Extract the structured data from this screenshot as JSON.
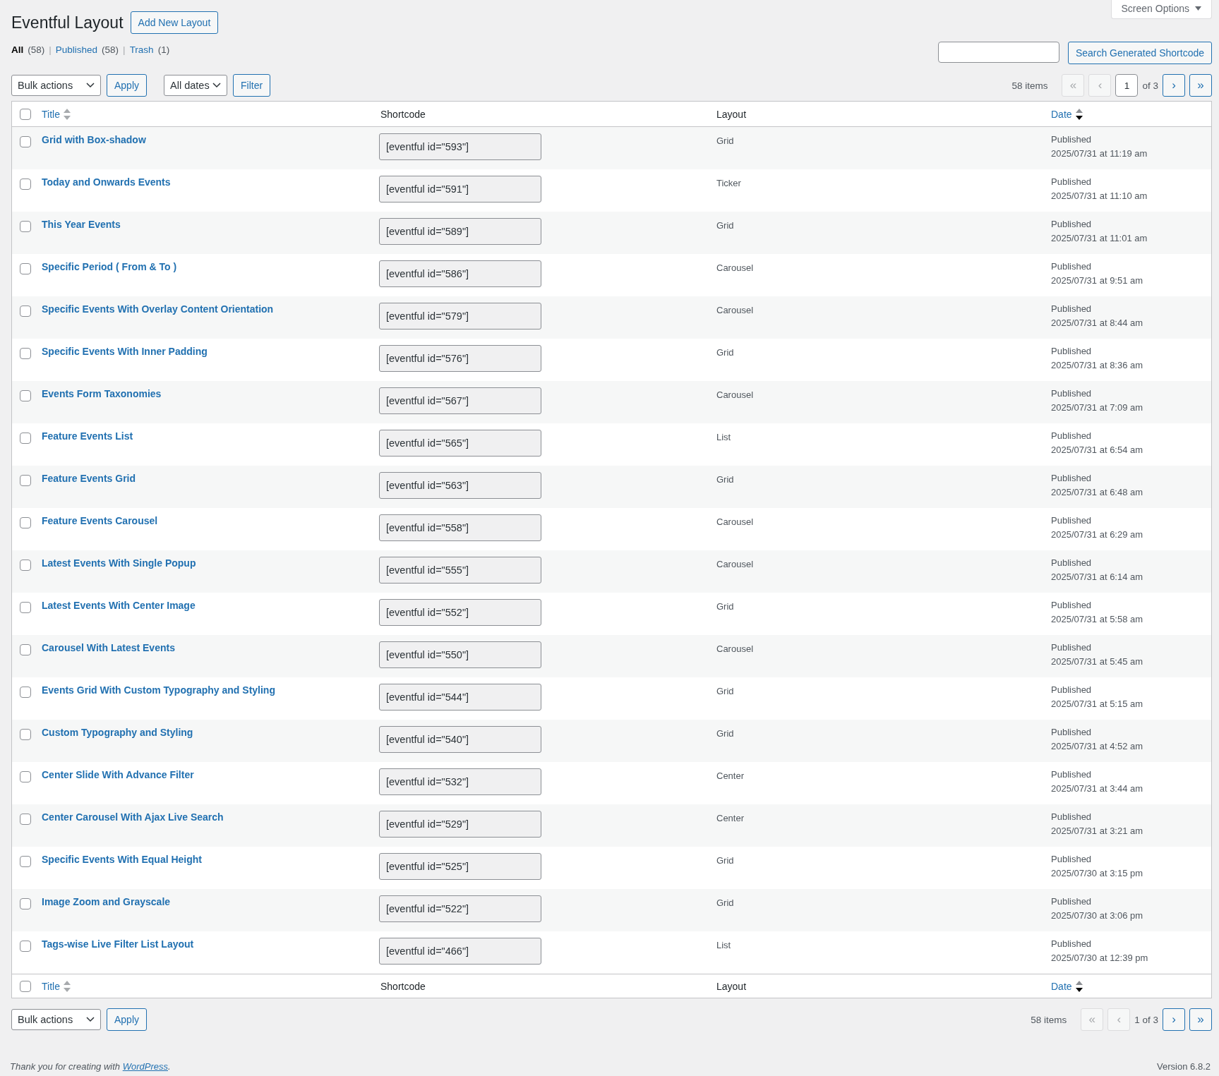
{
  "screen_options": {
    "label": "Screen Options",
    "expanded": false
  },
  "title": "Eventful Layout",
  "add_button": "Add New Layout",
  "views": [
    {
      "label": "All",
      "count": "(58)",
      "selected": true
    },
    {
      "label": "Published",
      "count": "(58)",
      "selected": false
    },
    {
      "label": "Trash",
      "count": "(1)",
      "selected": false
    }
  ],
  "view_separator": "|",
  "search": {
    "button": "Search Generated Shortcode"
  },
  "top_nav": {
    "bulk": "Bulk actions",
    "apply": "Apply",
    "dates": "All dates",
    "filter": "Filter",
    "items": "58 items",
    "page": "1",
    "of": "of 3",
    "buttons": [
      {
        "label": "«",
        "disabled": true
      },
      {
        "label": "‹",
        "disabled": true
      },
      {
        "label": "›",
        "disabled": false
      },
      {
        "label": "»",
        "disabled": false
      }
    ]
  },
  "columns": [
    {
      "label": "Title",
      "sortable": true,
      "sorted": false
    },
    {
      "label": "Shortcode",
      "sortable": false
    },
    {
      "label": "Layout",
      "sortable": false
    },
    {
      "label": "Date",
      "sortable": true,
      "sorted": true
    }
  ],
  "header_checked": false,
  "rows": [
    {
      "title": "Grid with Box-shadow",
      "shortcode": "[eventful id=\"593\"]",
      "layout": "Grid",
      "status": "Published",
      "date": "2025/07/31 at 11:19 am",
      "checked": false
    },
    {
      "title": "Today and Onwards Events",
      "shortcode": "[eventful id=\"591\"]",
      "layout": "Ticker",
      "status": "Published",
      "date": "2025/07/31 at 11:10 am",
      "checked": false
    },
    {
      "title": "This Year Events",
      "shortcode": "[eventful id=\"589\"]",
      "layout": "Grid",
      "status": "Published",
      "date": "2025/07/31 at 11:01 am",
      "checked": false
    },
    {
      "title": "Specific Period ( From & To )",
      "shortcode": "[eventful id=\"586\"]",
      "layout": "Carousel",
      "status": "Published",
      "date": "2025/07/31 at 9:51 am",
      "checked": false
    },
    {
      "title": "Specific Events With Overlay Content Orientation",
      "shortcode": "[eventful id=\"579\"]",
      "layout": "Carousel",
      "status": "Published",
      "date": "2025/07/31 at 8:44 am",
      "checked": false
    },
    {
      "title": "Specific Events With Inner Padding",
      "shortcode": "[eventful id=\"576\"]",
      "layout": "Grid",
      "status": "Published",
      "date": "2025/07/31 at 8:36 am",
      "checked": false
    },
    {
      "title": "Events Form Taxonomies",
      "shortcode": "[eventful id=\"567\"]",
      "layout": "Carousel",
      "status": "Published",
      "date": "2025/07/31 at 7:09 am",
      "checked": false
    },
    {
      "title": "Feature Events List",
      "shortcode": "[eventful id=\"565\"]",
      "layout": "List",
      "status": "Published",
      "date": "2025/07/31 at 6:54 am",
      "checked": false
    },
    {
      "title": "Feature Events Grid",
      "shortcode": "[eventful id=\"563\"]",
      "layout": "Grid",
      "status": "Published",
      "date": "2025/07/31 at 6:48 am",
      "checked": false
    },
    {
      "title": "Feature Events Carousel",
      "shortcode": "[eventful id=\"558\"]",
      "layout": "Carousel",
      "status": "Published",
      "date": "2025/07/31 at 6:29 am",
      "checked": false
    },
    {
      "title": "Latest Events With Single Popup",
      "shortcode": "[eventful id=\"555\"]",
      "layout": "Carousel",
      "status": "Published",
      "date": "2025/07/31 at 6:14 am",
      "checked": false
    },
    {
      "title": "Latest Events With Center Image",
      "shortcode": "[eventful id=\"552\"]",
      "layout": "Grid",
      "status": "Published",
      "date": "2025/07/31 at 5:58 am",
      "checked": false
    },
    {
      "title": "Carousel With Latest Events",
      "shortcode": "[eventful id=\"550\"]",
      "layout": "Carousel",
      "status": "Published",
      "date": "2025/07/31 at 5:45 am",
      "checked": false
    },
    {
      "title": "Events Grid With Custom Typography and Styling",
      "shortcode": "[eventful id=\"544\"]",
      "layout": "Grid",
      "status": "Published",
      "date": "2025/07/31 at 5:15 am",
      "checked": false
    },
    {
      "title": "Custom Typography and Styling",
      "shortcode": "[eventful id=\"540\"]",
      "layout": "Grid",
      "status": "Published",
      "date": "2025/07/31 at 4:52 am",
      "checked": false
    },
    {
      "title": "Center Slide With Advance Filter",
      "shortcode": "[eventful id=\"532\"]",
      "layout": "Center",
      "status": "Published",
      "date": "2025/07/31 at 3:44 am",
      "checked": false
    },
    {
      "title": "Center Carousel With Ajax Live Search",
      "shortcode": "[eventful id=\"529\"]",
      "layout": "Center",
      "status": "Published",
      "date": "2025/07/31 at 3:21 am",
      "checked": false
    },
    {
      "title": "Specific Events With Equal Height",
      "shortcode": "[eventful id=\"525\"]",
      "layout": "Grid",
      "status": "Published",
      "date": "2025/07/30 at 3:15 pm",
      "checked": false
    },
    {
      "title": "Image Zoom and Grayscale",
      "shortcode": "[eventful id=\"522\"]",
      "layout": "Grid",
      "status": "Published",
      "date": "2025/07/30 at 3:06 pm",
      "checked": false
    },
    {
      "title": "Tags-wise Live Filter List Layout",
      "shortcode": "[eventful id=\"466\"]",
      "layout": "List",
      "status": "Published",
      "date": "2025/07/30 at 12:39 pm",
      "checked": false
    }
  ],
  "footer_columns": [
    {
      "label": "Title",
      "sortable": true,
      "sorted": false
    },
    {
      "label": "Shortcode",
      "sortable": false
    },
    {
      "label": "Layout",
      "sortable": false
    },
    {
      "label": "Date",
      "sortable": true,
      "sorted": true
    }
  ],
  "footer_checked": false,
  "bottom_nav": {
    "bulk": "Bulk actions",
    "apply": "Apply",
    "items": "58 items",
    "pages": "1 of 3",
    "buttons": [
      {
        "label": "«",
        "disabled": true
      },
      {
        "label": "‹",
        "disabled": true
      },
      {
        "label": "›",
        "disabled": false
      },
      {
        "label": "»",
        "disabled": false
      }
    ]
  },
  "footer": {
    "thanks": "Thank you for creating with ",
    "link": "WordPress",
    "end": ".",
    "version": "Version 6.8.2"
  }
}
